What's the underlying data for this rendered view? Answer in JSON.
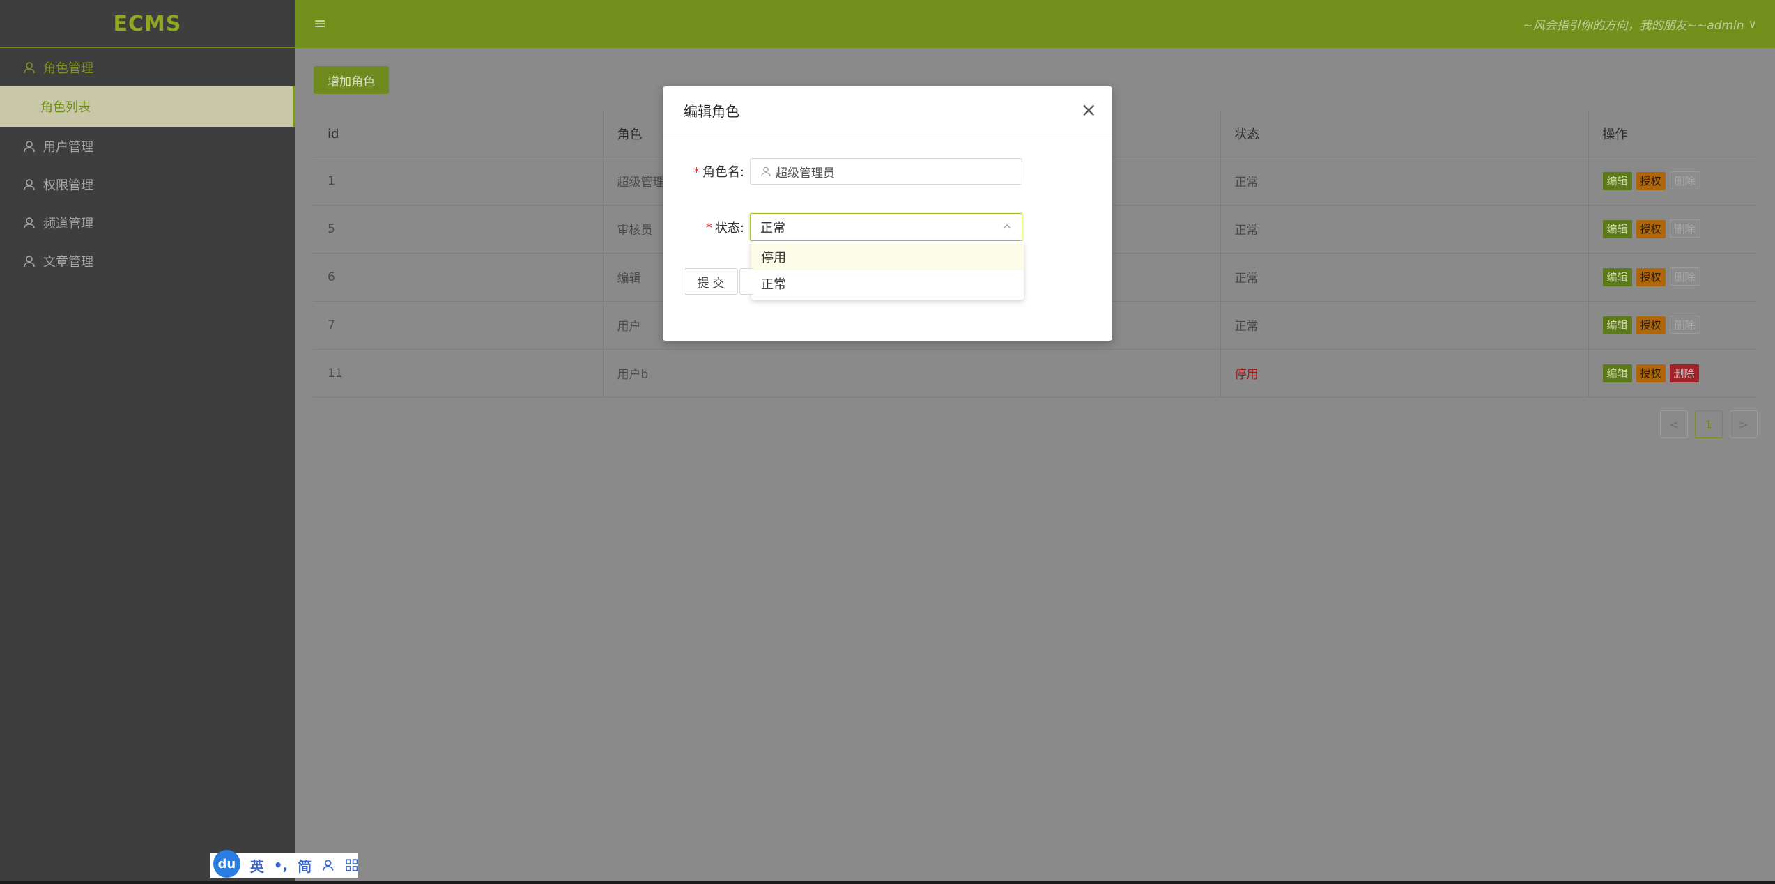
{
  "app": {
    "logo": "ECMS"
  },
  "header": {
    "hamburger": "≡",
    "user_text": "~风会指引你的方向，我的朋友~~admin",
    "user_caret": "∨"
  },
  "sidebar": {
    "groups": [
      {
        "label": "角色管理",
        "active": true
      },
      {
        "label": "用户管理"
      },
      {
        "label": "权限管理"
      },
      {
        "label": "频道管理"
      },
      {
        "label": "文章管理"
      }
    ],
    "submenu": {
      "label": "角色列表"
    }
  },
  "main": {
    "add_button": "增加角色",
    "table": {
      "headers": [
        "id",
        "角色",
        "状态",
        "操作"
      ],
      "rows": [
        {
          "id": "1",
          "role": "超级管理员",
          "status": "正常",
          "stopped": false
        },
        {
          "id": "5",
          "role": "审核员",
          "status": "正常",
          "stopped": false
        },
        {
          "id": "6",
          "role": "编辑",
          "status": "正常",
          "stopped": false
        },
        {
          "id": "7",
          "role": "用户",
          "status": "正常",
          "stopped": false
        },
        {
          "id": "11",
          "role": "用户b",
          "status": "停用",
          "stopped": true
        }
      ],
      "actions": {
        "edit": "编辑",
        "auth": "授权",
        "delete": "删除"
      }
    },
    "pager": {
      "prev": "<",
      "current": "1",
      "next": ">"
    }
  },
  "modal": {
    "title": "编辑角色",
    "close": "×",
    "role_name": {
      "label": "角色名:",
      "value": "超级管理员"
    },
    "status": {
      "label": "状态:",
      "value": "正常",
      "options": [
        "停用",
        "正常"
      ]
    },
    "submit": "提 交"
  },
  "ime": {
    "logo": "du",
    "items": [
      "英",
      "•,",
      "简"
    ]
  },
  "colors": {
    "brand": "#70901b",
    "danger": "#a3222a",
    "warning": "#b0660a"
  }
}
